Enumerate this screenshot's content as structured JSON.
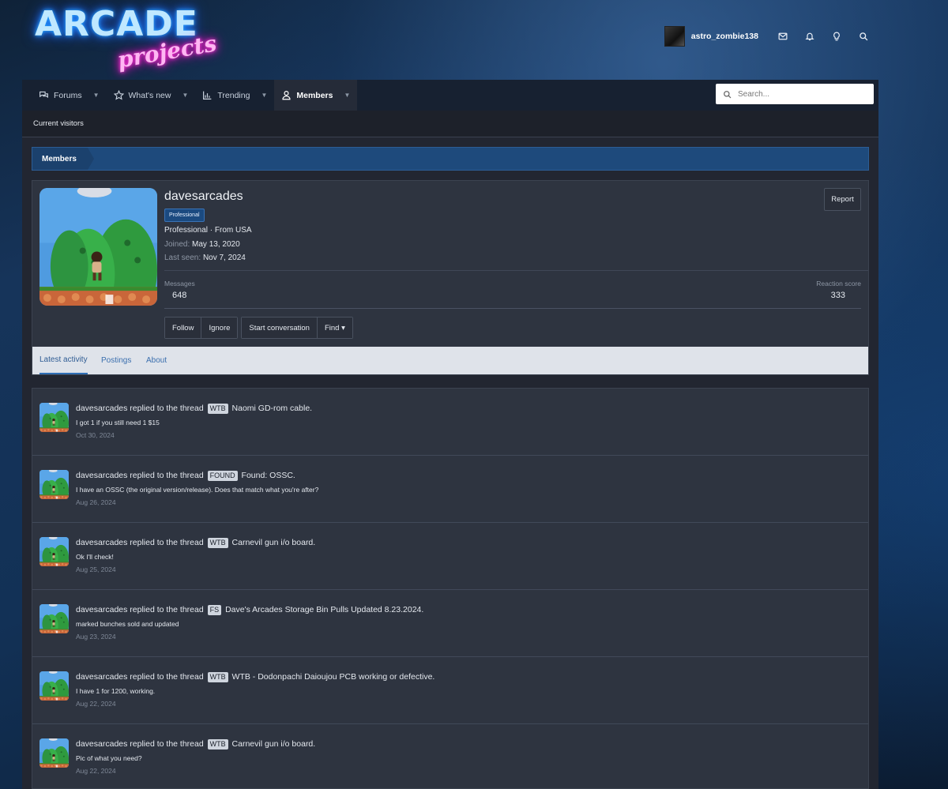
{
  "header": {
    "logo_main": "ARCADE",
    "logo_sub": "projects",
    "username": "astro_zombie138",
    "icons": [
      "envelope-icon",
      "bell-icon",
      "lightbulb-icon",
      "search-icon"
    ]
  },
  "nav": {
    "tabs": [
      {
        "label": "Forums",
        "icon": "speech-bubbles-icon"
      },
      {
        "label": "What's new",
        "icon": "star-icon"
      },
      {
        "label": "Trending",
        "icon": "bar-chart-icon"
      },
      {
        "label": "Members",
        "icon": "user-icon"
      }
    ],
    "search_placeholder": "Search..."
  },
  "subnav": {
    "current_visitors": "Current visitors"
  },
  "breadcrumb": {
    "members": "Members"
  },
  "profile": {
    "name": "davesarcades",
    "badge": "Professional",
    "title_line": "Professional · From USA",
    "joined_label": "Joined:",
    "joined_value": "May 13, 2020",
    "last_seen_label": "Last seen:",
    "last_seen_value": "Nov 7, 2024",
    "report": "Report",
    "messages_label": "Messages",
    "messages_value": "648",
    "reaction_label": "Reaction score",
    "reaction_value": "333",
    "follow": "Follow",
    "ignore": "Ignore",
    "start_conversation": "Start conversation",
    "find": "Find ▾",
    "tabs": [
      "Latest activity",
      "Postings",
      "About"
    ]
  },
  "activity": [
    {
      "user": "davesarcades",
      "verb": "replied to the thread",
      "prefix": "WTB",
      "thread": "Naomi GD-rom cable.",
      "snippet": "I got 1 if you still need 1 $15",
      "date": "Oct 30, 2024"
    },
    {
      "user": "davesarcades",
      "verb": "replied to the thread",
      "prefix": "FOUND",
      "thread": "Found: OSSC.",
      "snippet": "I have an OSSC (the original version/release). Does that match what you're after?",
      "date": "Aug 26, 2024"
    },
    {
      "user": "davesarcades",
      "verb": "replied to the thread",
      "prefix": "WTB",
      "thread": "Carnevil gun i/o board.",
      "snippet": "Ok I'll check!",
      "date": "Aug 25, 2024"
    },
    {
      "user": "davesarcades",
      "verb": "replied to the thread",
      "prefix": "FS",
      "thread": "Dave's Arcades Storage Bin Pulls Updated 8.23.2024.",
      "snippet": "marked bunches sold and updated",
      "date": "Aug 23, 2024"
    },
    {
      "user": "davesarcades",
      "verb": "replied to the thread",
      "prefix": "WTB",
      "thread": "WTB - Dodonpachi Daioujou PCB working or defective.",
      "snippet": "I have 1 for 1200, working.",
      "date": "Aug 22, 2024"
    },
    {
      "user": "davesarcades",
      "verb": "replied to the thread",
      "prefix": "WTB",
      "thread": "Carnevil gun i/o board.",
      "snippet": "Pic of what you need?",
      "date": "Aug 22, 2024"
    }
  ]
}
